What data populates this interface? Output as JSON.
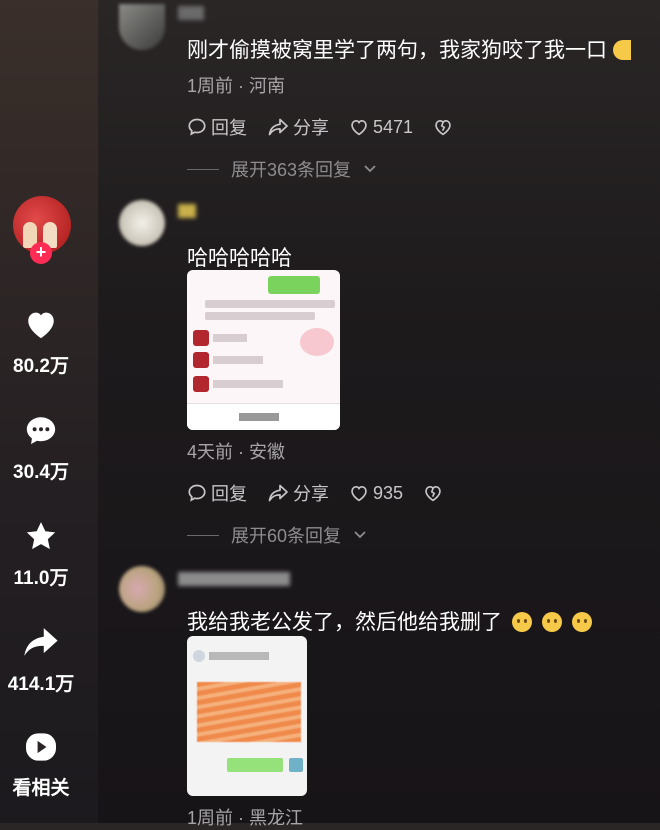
{
  "sidebar": {
    "like_count": "80.2万",
    "comment_count": "30.4万",
    "favorite_count": "11.0万",
    "share_count": "414.1万",
    "related_label": "看相关"
  },
  "comments": [
    {
      "text": "刚才偷摸被窝里学了两句，我家狗咬了我一口",
      "meta": "1周前 · 河南",
      "reply_label": "回复",
      "share_label": "分享",
      "likes": "5471",
      "expand_label": "展开363条回复"
    },
    {
      "text": "哈哈哈哈哈",
      "meta": "4天前 · 安徽",
      "reply_label": "回复",
      "share_label": "分享",
      "likes": "935",
      "expand_label": "展开60条回复"
    },
    {
      "text": "我给我老公发了，然后他给我删了",
      "meta": "1周前 · 黑龙江"
    }
  ],
  "colors": {
    "accent": "#fe2c55",
    "background": "#1d1a1c"
  }
}
